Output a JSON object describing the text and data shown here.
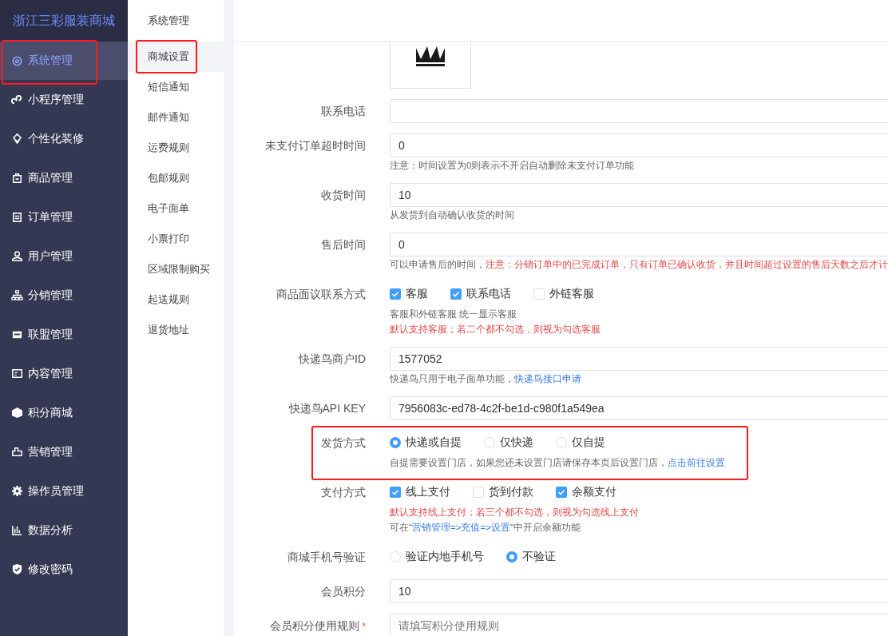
{
  "sidebar": {
    "title": "浙江三彩服装商城",
    "items": [
      {
        "label": "系统管理",
        "selected": true,
        "highlighted": true
      },
      {
        "label": "小程序管理",
        "selected": false,
        "highlighted": false
      },
      {
        "label": "个性化装修",
        "selected": false,
        "highlighted": false
      },
      {
        "label": "商品管理",
        "selected": false,
        "highlighted": false
      },
      {
        "label": "订单管理",
        "selected": false,
        "highlighted": false
      },
      {
        "label": "用户管理",
        "selected": false,
        "highlighted": false
      },
      {
        "label": "分销管理",
        "selected": false,
        "highlighted": false
      },
      {
        "label": "联盟管理",
        "selected": false,
        "highlighted": false
      },
      {
        "label": "内容管理",
        "selected": false,
        "highlighted": false
      },
      {
        "label": "积分商城",
        "selected": false,
        "highlighted": false
      },
      {
        "label": "营销管理",
        "selected": false,
        "highlighted": false
      },
      {
        "label": "操作员管理",
        "selected": false,
        "highlighted": false
      },
      {
        "label": "数据分析",
        "selected": false,
        "highlighted": false
      },
      {
        "label": "修改密码",
        "selected": false,
        "highlighted": false
      }
    ]
  },
  "subnav": {
    "title": "系统管理",
    "items": [
      {
        "label": "商城设置",
        "selected": true,
        "highlighted": true
      },
      {
        "label": "短信通知",
        "selected": false,
        "highlighted": false
      },
      {
        "label": "邮件通知",
        "selected": false,
        "highlighted": false
      },
      {
        "label": "运费规则",
        "selected": false,
        "highlighted": false
      },
      {
        "label": "包邮规则",
        "selected": false,
        "highlighted": false
      },
      {
        "label": "电子面单",
        "selected": false,
        "highlighted": false
      },
      {
        "label": "小票打印",
        "selected": false,
        "highlighted": false
      },
      {
        "label": "区域限制购买",
        "selected": false,
        "highlighted": false
      },
      {
        "label": "起送规则",
        "selected": false,
        "highlighted": false
      },
      {
        "label": "退货地址",
        "selected": false,
        "highlighted": false
      }
    ]
  },
  "form": {
    "rows": [
      {
        "kind": "image"
      },
      {
        "kind": "input",
        "label": "联系电话"
      },
      {
        "kind": "input",
        "label": "未支付订单超时时间",
        "value": "0",
        "notes": [
          [
            {
              "kind": "plain",
              "text": "注意：时间设置为0则表示不开启自动删除未支付订单功能"
            }
          ]
        ]
      },
      {
        "kind": "input",
        "label": "收货时间",
        "value": "10",
        "notes": [
          [
            {
              "kind": "plain",
              "text": "从发货到自动确认收货的时间"
            }
          ]
        ]
      },
      {
        "kind": "input",
        "label": "售后时间",
        "value": "0",
        "notes": [
          [
            {
              "kind": "plain",
              "text": "可以申请售后的时间，"
            },
            {
              "kind": "warning",
              "text": "注意：分销订单中的已完成订单，只有订单已确认收货，并且时间超过设置的售后天数之后才计"
            }
          ]
        ]
      },
      {
        "kind": "checkbox",
        "label": "商品面议联系方式",
        "options": [
          {
            "label": "客服",
            "checked": true
          },
          {
            "label": "联系电话",
            "checked": true
          },
          {
            "label": "外链客服",
            "checked": false
          }
        ],
        "notes": [
          [
            {
              "kind": "plain",
              "text": "客服和外链客服 统一显示客服"
            }
          ],
          [
            {
              "kind": "warning",
              "text": "默认支持客服；若二个都不勾选，则视为勾选客服"
            }
          ]
        ]
      },
      {
        "kind": "input",
        "label": "快递鸟商户ID",
        "value": "1577052",
        "notes": [
          [
            {
              "kind": "plain",
              "text": "快递鸟只用于电子面单功能，"
            },
            {
              "kind": "link",
              "text": "快递鸟接口申请"
            }
          ]
        ]
      },
      {
        "kind": "input",
        "label": "快递鸟API KEY",
        "value": "7956083c-ed78-4c2f-be1d-c980f1a549ea"
      },
      {
        "kind": "radio",
        "label": "发货方式",
        "highlighted": true,
        "options": [
          {
            "label": "快递或自提",
            "selected": true
          },
          {
            "label": "仅快递",
            "selected": false
          },
          {
            "label": "仅自提",
            "selected": false
          }
        ],
        "notes": [
          [
            {
              "kind": "plain",
              "text": "自提需要设置门店，如果您还未设置门店请保存本页后设置门店，"
            },
            {
              "kind": "link",
              "text": "点击前往设置"
            }
          ]
        ]
      },
      {
        "kind": "checkbox",
        "label": "支付方式",
        "options": [
          {
            "label": "线上支付",
            "checked": true
          },
          {
            "label": "货到付款",
            "checked": false
          },
          {
            "label": "余额支付",
            "checked": true
          }
        ],
        "notes": [
          [
            {
              "kind": "warning",
              "text": "默认支持线上支付；若三个都不勾选，则视为勾选线上支付"
            }
          ],
          [
            {
              "kind": "plain",
              "text": "可在“"
            },
            {
              "kind": "link",
              "text": "营销管理=>充值=>设置"
            },
            {
              "kind": "plain",
              "text": "”中开启余额功能"
            }
          ]
        ]
      },
      {
        "kind": "radio",
        "label": "商城手机号验证",
        "options": [
          {
            "label": "验证内地手机号",
            "selected": false
          },
          {
            "label": "不验证",
            "selected": true
          }
        ]
      },
      {
        "kind": "input",
        "label": "会员积分",
        "value": "10"
      },
      {
        "kind": "input",
        "label": "会员积分使用规则",
        "required_mark": "*",
        "placeholder": "请填写积分使用规则"
      }
    ]
  }
}
